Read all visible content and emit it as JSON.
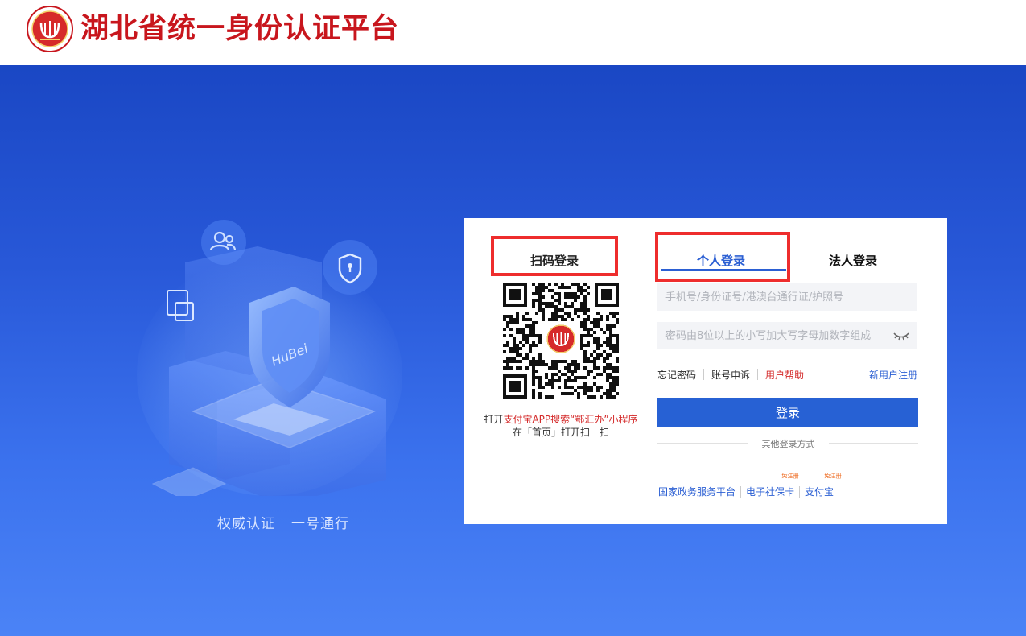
{
  "header": {
    "title": "湖北省统一身份认证平台",
    "logo_icon": "provincial-emblem-icon"
  },
  "banner": {
    "slogan_left": "权威认证",
    "slogan_right": "一号通行",
    "illustration_text": "HuBei"
  },
  "qr_login": {
    "title": "扫码登录",
    "hint_prefix": "打开",
    "hint_app": "支付宝APP搜索“鄂汇办”小程序",
    "hint_line2": "在「首页」打开扫一扫"
  },
  "tabs": {
    "personal": "个人登录",
    "legal": "法人登录"
  },
  "form": {
    "username_placeholder": "手机号/身份证号/港澳台通行证/护照号",
    "password_placeholder": "密码由8位以上的小写加大写字母加数字组成",
    "forgot": "忘记密码",
    "appeal": "账号申诉",
    "help": "用户帮助",
    "register": "新用户注册",
    "login_button": "登录"
  },
  "other_login": {
    "title": "其他登录方式",
    "badge": "免注册",
    "links": [
      "国家政务服务平台",
      "电子社保卡",
      "支付宝"
    ]
  },
  "colors": {
    "brand_red": "#c8161d",
    "primary_blue": "#2761d4",
    "highlight_red": "#ee2d2d",
    "banner_top": "#1a47c4",
    "banner_bottom": "#4b83f6"
  }
}
